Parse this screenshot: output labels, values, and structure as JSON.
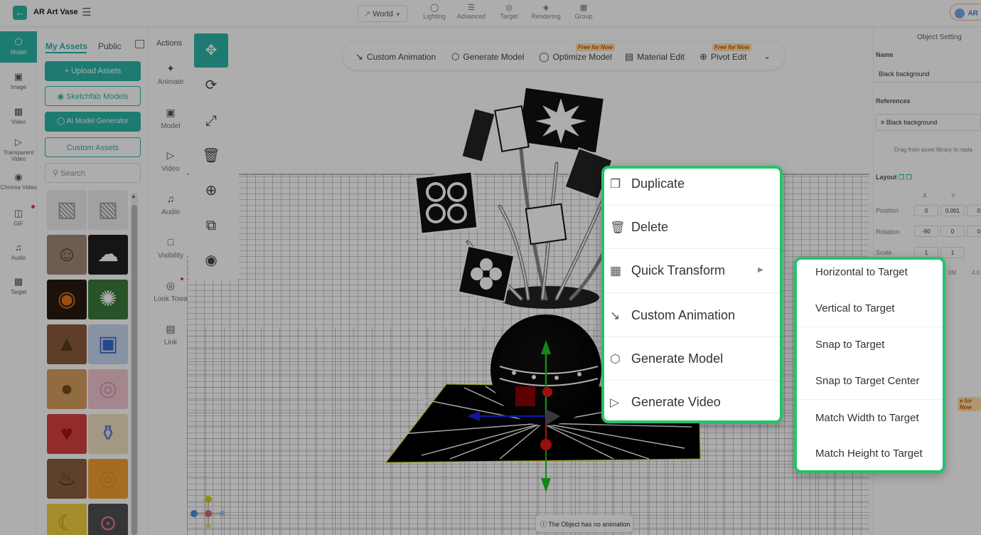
{
  "app": {
    "title": "AR Art Vase"
  },
  "topbar": {
    "space_select": "World",
    "tabs": [
      {
        "label": "Lighting",
        "icon": "bulb-icon"
      },
      {
        "label": "Advanced",
        "icon": "sliders-icon"
      },
      {
        "label": "Target",
        "icon": "target-icon"
      },
      {
        "label": "Rendering",
        "icon": "paint-icon"
      },
      {
        "label": "Group",
        "icon": "group-icon"
      }
    ],
    "account_badge": "AR"
  },
  "leftbar": [
    {
      "label": "Model",
      "icon": "cube-icon",
      "active": true
    },
    {
      "label": "Image",
      "icon": "image-icon"
    },
    {
      "label": "Video",
      "icon": "video-icon"
    },
    {
      "label": "Transparent Video",
      "icon": "transparent-video-icon"
    },
    {
      "label": "Chroma Video",
      "icon": "chroma-video-icon"
    },
    {
      "label": "GIF",
      "icon": "gif-icon"
    },
    {
      "label": "Audio",
      "icon": "audio-icon"
    },
    {
      "label": "Target",
      "icon": "target-icon"
    }
  ],
  "assets": {
    "tab_my": "My Assets",
    "tab_public": "Public",
    "upload": "Upload Assets",
    "sketchfab": "Sketchfab Models",
    "ai_generator": "AI Model Generator",
    "custom": "Custom Assets",
    "search_placeholder": "Search",
    "thumbnails": [
      "box model",
      "box model",
      "face mask",
      "ghost",
      "pumpkin",
      "candy",
      "mud",
      "milk box",
      "cookie",
      "donut",
      "strawberry",
      "bottle",
      "stew",
      "ring donut",
      "banana",
      "lollipop"
    ]
  },
  "actions": {
    "title": "Actions",
    "items": [
      "Animate",
      "Model",
      "Video",
      "Audio",
      "Visibility",
      "Look Towa",
      "Link"
    ]
  },
  "viewport_toolbar": {
    "items": [
      {
        "label": "Custom Animation",
        "icon": "custom-animation-icon"
      },
      {
        "label": "Generate Model",
        "icon": "generate-model-icon"
      },
      {
        "label": "Optimize Model",
        "icon": "optimize-icon",
        "badge": "Free for Now"
      },
      {
        "label": "Material Edit",
        "icon": "material-icon"
      },
      {
        "label": "Pivot Edit",
        "icon": "pivot-icon",
        "badge": "Free for Now"
      }
    ]
  },
  "context_menu": {
    "items": [
      {
        "label": "Duplicate",
        "icon": "duplicate-icon"
      },
      {
        "label": "Delete",
        "icon": "trash-icon"
      },
      {
        "label": "Quick Transform",
        "icon": "grid-icon"
      },
      {
        "label": "Custom Animation",
        "icon": "custom-animation-icon"
      },
      {
        "label": "Generate Model",
        "icon": "generate-model-icon"
      },
      {
        "label": "Generate Video",
        "icon": "generate-video-icon"
      }
    ]
  },
  "submenu": {
    "items": [
      "Horizontal to Target",
      "Vertical to Target",
      "Snap to Target",
      "Snap to Target Center",
      "Match Width to Target",
      "Match Height to Target"
    ]
  },
  "right_panel": {
    "title": "Object Setting",
    "name_label": "Name",
    "name_value": "Black background",
    "references_label": "References",
    "reference_value": "Black background",
    "drag_hint": "Drag from asset library to repla",
    "layout_label": "Layout",
    "col_x": "X",
    "col_y": "Y",
    "position_label": "Position",
    "position": [
      "0",
      "0.001",
      "0"
    ],
    "rotation_label": "Rotation",
    "rotation": [
      "-90",
      "0",
      "0"
    ],
    "scale_label": "Scale",
    "scale": [
      "1",
      "1"
    ],
    "extra1": "0M",
    "extra2": "4.0",
    "free_tag": "e for Now"
  },
  "toast": "The Object has no animation"
}
